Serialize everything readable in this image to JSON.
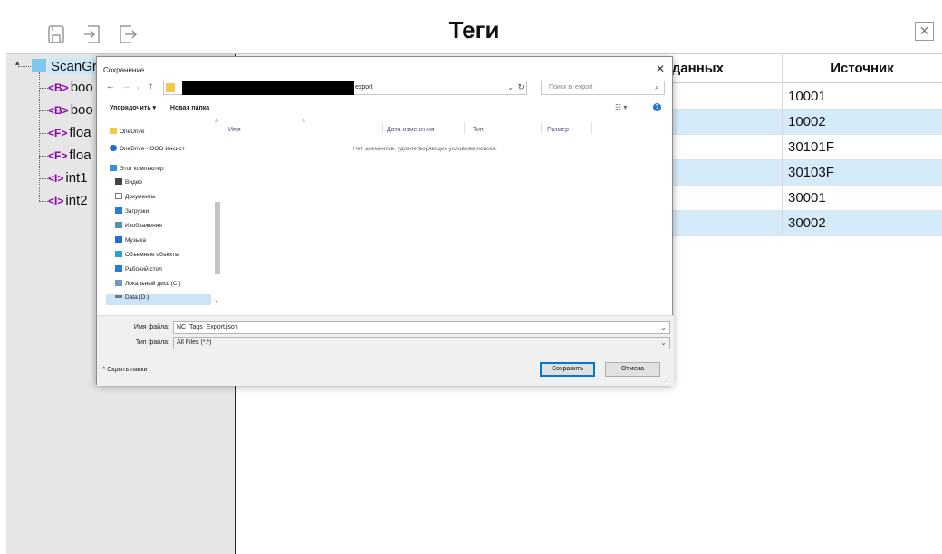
{
  "app": {
    "title": "Теги",
    "columns": [
      "",
      "",
      "л данных",
      "Источник"
    ],
    "source_values": [
      "10001",
      "10002",
      "30101F",
      "30103F",
      "30001",
      "30002"
    ]
  },
  "tree": {
    "root": "ScanGr",
    "items": [
      {
        "tag": "<B>",
        "label": "boo"
      },
      {
        "tag": "<B>",
        "label": "boo"
      },
      {
        "tag": "<F>",
        "label": "floa"
      },
      {
        "tag": "<F>",
        "label": "floa"
      },
      {
        "tag": "<I>",
        "label": "int1"
      },
      {
        "tag": "<I>",
        "label": "int2"
      }
    ]
  },
  "dialog": {
    "title": "Сохранение",
    "address_tail": "export",
    "search_placeholder": "Поиск в: export",
    "organize": "Упорядочить ▾",
    "new_folder": "Новая папка",
    "nav_items": [
      {
        "label": "OneDrive",
        "icon": "folder-icon",
        "color": "#f2c94c"
      },
      {
        "label": "OneDrive - ООО Инсист",
        "icon": "cloud-icon",
        "color": "#1e6fd0"
      },
      {
        "label": "Этот компьютер",
        "icon": "computer-icon",
        "color": "#3c8fd9"
      },
      {
        "label": "Видео",
        "icon": "video-icon",
        "color": "#444"
      },
      {
        "label": "Документы",
        "icon": "documents-icon",
        "color": "#777"
      },
      {
        "label": "Загрузки",
        "icon": "downloads-icon",
        "color": "#2a7bd1"
      },
      {
        "label": "Изображения",
        "icon": "images-icon",
        "color": "#5a8fb5"
      },
      {
        "label": "Музыка",
        "icon": "music-icon",
        "color": "#1e6fd0"
      },
      {
        "label": "Объемные объекты",
        "icon": "3d-objects-icon",
        "color": "#2aa1d8"
      },
      {
        "label": "Рабочий стол",
        "icon": "desktop-icon",
        "color": "#2a7bd1"
      },
      {
        "label": "Локальный диск (C:)",
        "icon": "drive-icon",
        "color": "#6b9ac4"
      },
      {
        "label": "Data (D:)",
        "icon": "drive-icon",
        "color": "#777"
      }
    ],
    "columns": [
      "Имя",
      "Дата изменения",
      "Тип",
      "Размер"
    ],
    "empty_message": "Нет элементов, удовлетворяющих условиям поиска.",
    "filename_label": "Имя файла:",
    "filename_value": "NC_Tags_Export.json",
    "filetype_label": "Тип файла:",
    "filetype_value": "All Files (*.*)",
    "hide_folders": "Скрыть папки",
    "save_button": "Сохранить",
    "cancel_button": "Отмена"
  }
}
